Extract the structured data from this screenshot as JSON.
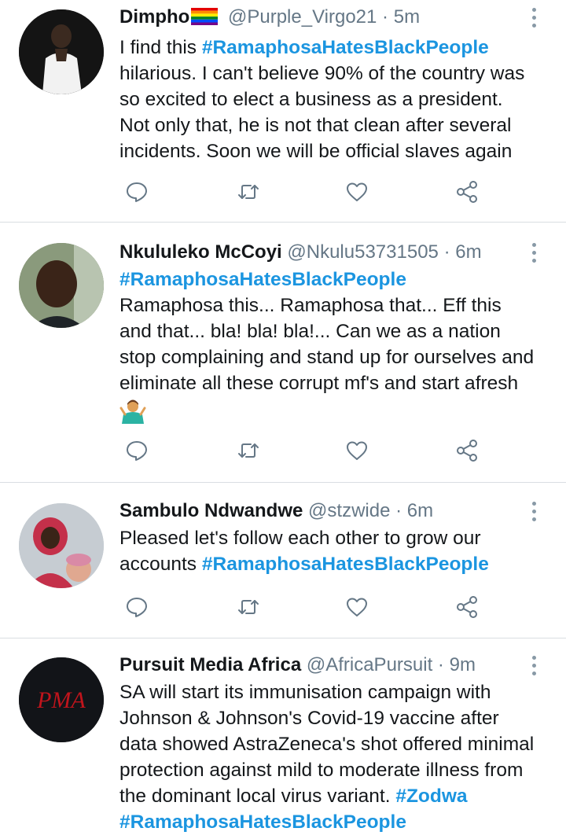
{
  "tweets": [
    {
      "name": "Dimpho",
      "handle": "@Purple_Virgo21",
      "sep": "·",
      "time": "5m",
      "avatar_icon": "profile-photo",
      "text_before": "I find this ",
      "hashtag1": "#RamaphosaHatesBlackPeople",
      "text_after": " hilarious. I can't believe 90% of the country was so excited to elect a business as a president. Not only that, he is not that clean after several incidents. Soon we will be official slaves again"
    },
    {
      "name": "Nkululeko McCoyi",
      "handle": "@Nkulu53731505",
      "sep": "·",
      "time": "6m",
      "avatar_icon": "profile-photo",
      "hashtag1": "#RamaphosaHatesBlackPeople",
      "text_after": "Ramaphosa this... Ramaphosa that... Eff this and that... bla! bla! bla!... Can we as a nation stop complaining and stand up for ourselves and eliminate all these corrupt mf's and start afresh"
    },
    {
      "name": "Sambulo Ndwandwe",
      "handle": "@stzwide",
      "sep": "·",
      "time": "6m",
      "avatar_icon": "profile-photo",
      "text_before": "Pleased let's follow each other to grow our accounts ",
      "hashtag1": "#RamaphosaHatesBlackPeople"
    },
    {
      "name": "Pursuit Media Africa",
      "handle": "@AfricaPursuit",
      "sep": "·",
      "time": "9m",
      "avatar_icon": "pma-logo",
      "avatar_logo_text": "PMA",
      "text_before": "SA will start its immunisation campaign with Johnson & Johnson's Covid-19 vaccine after data showed AstraZeneca's shot offered minimal protection against mild to moderate illness from the dominant local virus variant. ",
      "hashtag1": "#Zodwa",
      "hashtag2": "#RamaphosaHatesBlackPeople"
    }
  ],
  "action_icons": [
    "reply-icon",
    "retweet-icon",
    "like-icon",
    "share-icon"
  ],
  "colors": {
    "hashtag": "#1b95e0",
    "secondary": "#657786",
    "divider": "#d9dee2"
  }
}
